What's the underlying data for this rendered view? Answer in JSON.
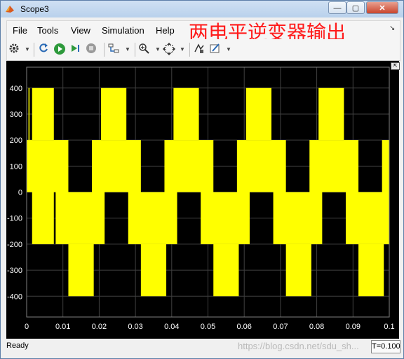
{
  "window": {
    "title": "Scope3",
    "minimize": "—",
    "maximize": "▢",
    "close": "✕"
  },
  "menu": {
    "items": [
      "File",
      "Tools",
      "View",
      "Simulation",
      "Help"
    ],
    "annotation": "两电平逆变器输出",
    "more": "↘"
  },
  "toolbar": {
    "icons": [
      "gear-icon",
      "restore-icon",
      "run-icon",
      "step-forward-icon",
      "stop-icon",
      "highlight-icon",
      "zoom-icon",
      "autoscale-icon",
      "cursor-icon",
      "style-icon"
    ]
  },
  "status": {
    "text": "Ready",
    "time": "T=0.100",
    "watermark": "https://blog.csdn.net/sdu_sh..."
  },
  "colors": {
    "trace": "#ffff00",
    "axes": "#000000",
    "grid": "#404040",
    "tick_text": "#ffffff"
  },
  "chart_data": {
    "type": "line",
    "title": "",
    "xlabel": "",
    "ylabel": "",
    "xlim": [
      0,
      0.1
    ],
    "ylim": [
      -480,
      480
    ],
    "x_ticks": [
      "0",
      "0.01",
      "0.02",
      "0.03",
      "0.04",
      "0.05",
      "0.06",
      "0.07",
      "0.08",
      "0.09",
      "0.1"
    ],
    "y_ticks": [
      "400",
      "300",
      "200",
      "100",
      "0",
      "-100",
      "-200",
      "-300",
      "-400"
    ],
    "grid": true,
    "series": [
      {
        "bands": [
          {
            "y0": 200,
            "y1": 400,
            "x": [
              [
                0.0005,
                0.0008
              ],
              [
                0.0015,
                0.0075
              ],
              [
                0.0205,
                0.0275
              ],
              [
                0.0405,
                0.0475
              ],
              [
                0.0605,
                0.0675
              ],
              [
                0.0805,
                0.0875
              ]
            ]
          },
          {
            "y0": 0,
            "y1": 200,
            "x": [
              [
                0,
                0.0115
              ],
              [
                0.018,
                0.0315
              ],
              [
                0.038,
                0.0515
              ],
              [
                0.058,
                0.0715
              ],
              [
                0.078,
                0.0915
              ],
              [
                0.098,
                0.1
              ]
            ]
          },
          {
            "y0": -200,
            "y1": 0,
            "x": [
              [
                0.0015,
                0.0075
              ],
              [
                0.008,
                0.0215
              ],
              [
                0.028,
                0.0415
              ],
              [
                0.048,
                0.0615
              ],
              [
                0.068,
                0.0815
              ],
              [
                0.088,
                0.1
              ]
            ]
          },
          {
            "y0": -400,
            "y1": -200,
            "x": [
              [
                0.0115,
                0.0185
              ],
              [
                0.0315,
                0.0385
              ],
              [
                0.0515,
                0.0585
              ],
              [
                0.0715,
                0.0785
              ],
              [
                0.0915,
                0.0985
              ]
            ]
          }
        ]
      }
    ]
  }
}
